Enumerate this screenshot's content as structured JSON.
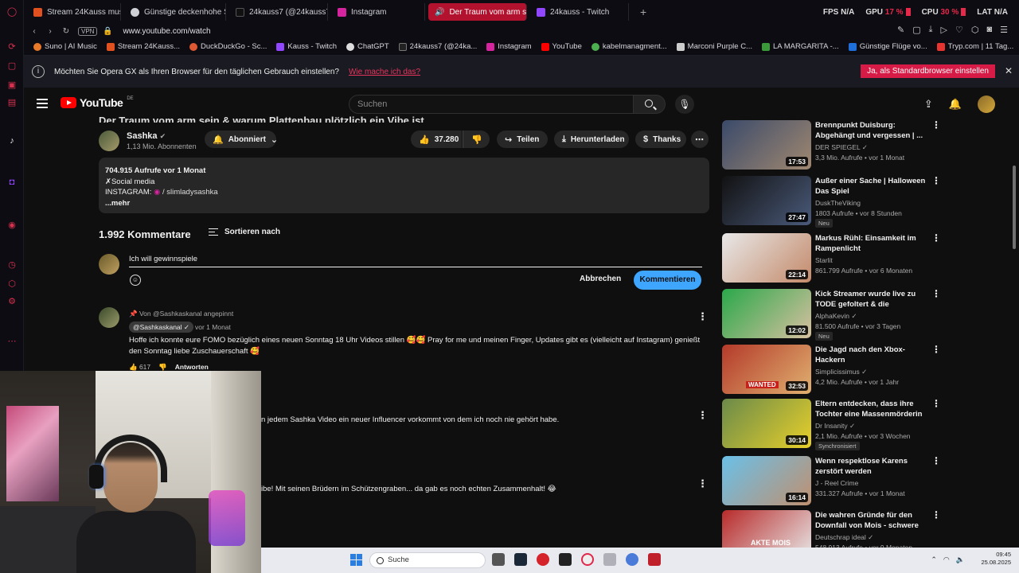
{
  "browser": {
    "tabs": [
      {
        "label": "Stream 24Kauss music | ...",
        "color": "#e0511f"
      },
      {
        "label": "Günstige deckenhohe Sc...",
        "color": "#cfcfd6"
      },
      {
        "label": "24kauss7 (@24kauss7) |",
        "color": "#111111"
      },
      {
        "label": "Instagram",
        "color": "#d6249f"
      },
      {
        "label": "Der Traum vom arm s",
        "color": "#ffffff",
        "active": true
      },
      {
        "label": "24kauss - Twitch",
        "color": "#9146ff"
      }
    ],
    "new_tab": "+",
    "sysmon": {
      "fps_label": "FPS",
      "fps_value": "N/A",
      "gpu_label": "GPU",
      "gpu_value": "17 %",
      "cpu_label": "CPU",
      "cpu_value": "30 %",
      "lat_label": "LAT",
      "lat_value": "N/A"
    },
    "vpn": "VPN",
    "url": "www.youtube.com/watch",
    "bookmarks": [
      {
        "label": "Suno | AI Music",
        "color": "#e87a2a"
      },
      {
        "label": "Stream 24Kauss...",
        "color": "#e0511f"
      },
      {
        "label": "DuckDuckGo - Sc...",
        "color": "#de5833"
      },
      {
        "label": "Kauss - Twitch",
        "color": "#9146ff"
      },
      {
        "label": "ChatGPT",
        "color": "#dddddd"
      },
      {
        "label": "24kauss7 (@24ka...",
        "color": "#222222"
      },
      {
        "label": "Instagram",
        "color": "#d6249f"
      },
      {
        "label": "YouTube",
        "color": "#ff0000"
      },
      {
        "label": "kabelmanagment...",
        "color": "#4caf50"
      },
      {
        "label": "Marconi Purple C...",
        "color": "#cccccc"
      },
      {
        "label": "LA MARGARITA -...",
        "color": "#3a9a3a"
      },
      {
        "label": "Günstige Flüge vo...",
        "color": "#1e6fd9"
      },
      {
        "label": "Tryp.com | 11 Tag...",
        "color": "#e8342e"
      }
    ]
  },
  "gx_prompt": {
    "message": "Möchten Sie Opera GX als Ihren Browser für den täglichen Gebrauch einstellen?",
    "link": "Wie mache ich das?",
    "confirm": "Ja, als Standardbrowser einstellen",
    "close": "✕"
  },
  "youtube": {
    "logo_text": "YouTube",
    "region": "DE",
    "search_placeholder": "Suchen",
    "video_title": "Der Traum vom arm sein & warum Plattenbau plötzlich ein Vibe ist",
    "channel": {
      "name": "Sashka",
      "subs": "1,13 Mio. Abonnenten"
    },
    "subscribe_label": "Abonniert",
    "likes": "37.280",
    "share": "Teilen",
    "download": "Herunterladen",
    "thanks": "Thanks",
    "description": {
      "stats": "704.915 Aufrufe  vor 1 Monat",
      "line1": "✗Social media",
      "line2_prefix": "INSTAGRAM: ",
      "line2_link": " / slimladysashka",
      "more": "...mehr"
    },
    "comments_count": "1.992 Kommentare",
    "sort_label": "Sortieren nach",
    "comment_draft": "Ich will gewinnspiele",
    "cancel": "Abbrechen",
    "submit": "Kommentieren",
    "comments": [
      {
        "pinned": "Von @Sashkaskanal angepinnt",
        "author": "@Sashkaskanal ✓",
        "time": "vor 1 Monat",
        "text": "Hoffe ich konnte eure FOMO bezüglich eines neuen Sonntag 18 Uhr Videos stillen 🥰🥰 Pray for me und meinen Finger, Updates gibt es (vielleicht auf Instagram) genießt den Sonntag liebe Zuschauerschaft 🥰",
        "likes": "617",
        "reply": "Antworten"
      },
      {
        "text": "n jedem Sashka Video ein neuer Influencer vorkommt von dem ich noch nie gehört habe."
      },
      {
        "text": "ibe! Mit seinen Brüdern im Schützengraben... da gab es noch echten Zusammenhalt! 😂"
      }
    ],
    "recommendations": [
      {
        "title": "Brennpunkt Duisburg: Abgehängt und vergessen | ...",
        "channel": "DER SPIEGEL ✓",
        "meta": "3,3 Mio. Aufrufe • vor 1 Monat",
        "duration": "17:53",
        "badge": "",
        "c1": "#3a4a6a",
        "c2": "#a08870"
      },
      {
        "title": "Außer einer Sache | Halloween Das Spiel",
        "channel": "DuskTheViking",
        "meta": "1803 Aufrufe • vor 8 Stunden",
        "duration": "27:47",
        "badge": "Neu",
        "c1": "#111111",
        "c2": "#4a5a7a"
      },
      {
        "title": "Markus Rühl: Einsamkeit im Rampenlicht",
        "channel": "Starlit",
        "meta": "861.799 Aufrufe • vor 6 Monaten",
        "duration": "22:14",
        "badge": "",
        "c1": "#e8e8e8",
        "c2": "#c48a6a"
      },
      {
        "title": "Kick Streamer wurde live zu TODE gefoltert & die Plattform...",
        "channel": "AlphaKevin ✓",
        "meta": "81.500 Aufrufe • vor 3 Tagen",
        "duration": "12:02",
        "badge": "Neu",
        "c1": "#2aa84a",
        "c2": "#d8c0a0"
      },
      {
        "title": "Die Jagd nach den Xbox-Hackern",
        "channel": "Simplicissimus ✓",
        "meta": "4,2 Mio. Aufrufe • vor 1 Jahr",
        "duration": "32:53",
        "badge": "",
        "c1": "#b43a2a",
        "c2": "#e0b070"
      },
      {
        "title": "Eltern entdecken, dass ihre Tochter eine Massenmörderin ...",
        "channel": "Dr Insanity ✓",
        "meta": "2,1 Mio. Aufrufe • vor 3 Wochen",
        "duration": "30:14",
        "badge": "Synchronisiert",
        "c1": "#e8d02a",
        "c2": "#6a8a4a"
      },
      {
        "title": "Wenn respektlose Karens zerstört werden",
        "channel": "J - Reel Crime",
        "meta": "331.327 Aufrufe • vor 1 Monat",
        "duration": "16:14",
        "badge": "",
        "c1": "#6ac0e8",
        "c2": "#c09070"
      },
      {
        "title": "Die wahren Gründe für den Downfall von Mois - schwere ...",
        "channel": "Deutschrap ideal ✓",
        "meta": "548.913 Aufrufe • vor 9 Monaten",
        "duration": "",
        "badge": "",
        "c1": "#b82a2a",
        "c2": "#e8e8e8"
      }
    ],
    "thumb_text": {
      "r5": "WANTED",
      "r8": "AKTE MOIS"
    }
  },
  "taskbar": {
    "search": "Suche",
    "time": "09:45",
    "date": "25.08.2025"
  }
}
